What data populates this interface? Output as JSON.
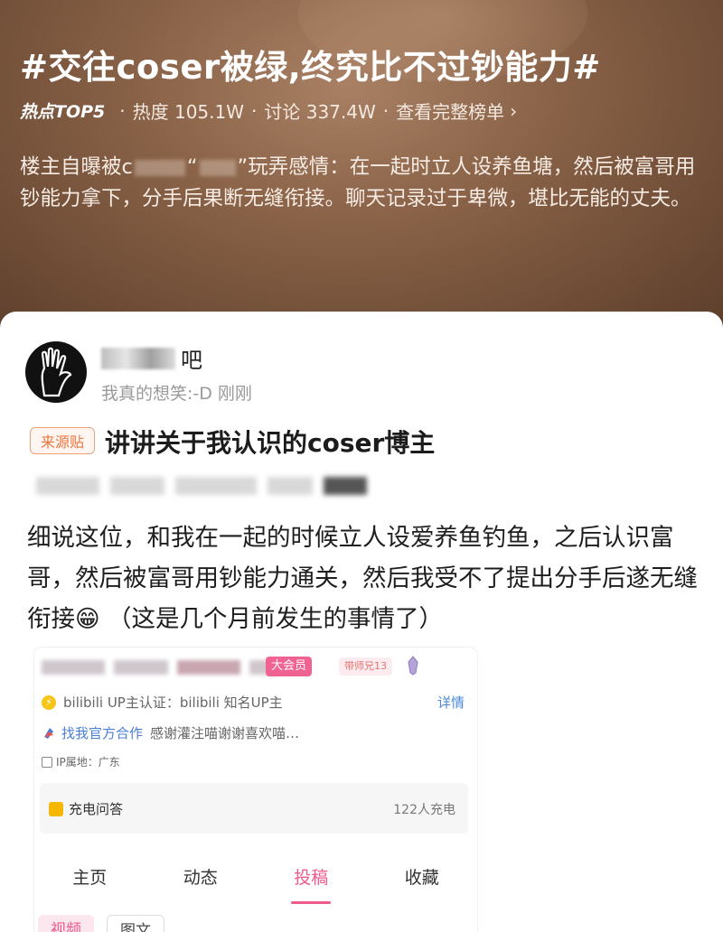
{
  "topic": {
    "title": "#交往coser被绿,终究比不过钞能力#",
    "badge": "热点TOP5",
    "heat": "热度 105.1W",
    "discussion": "讨论 337.4W",
    "full_list_link": "查看完整榜单",
    "desc_part1": "楼主自曝被c",
    "desc_part2": "玩弄感情：在一起时立人设养鱼塘，然后被富哥用钞能力拿下，分手后果断无缝衔接。聊天记录过于卑微，堪比无能的丈夫。"
  },
  "post": {
    "username_suffix": "吧",
    "subline": "我真的想笑:-D 刚刚",
    "source_tag": "来源贴",
    "title": "讲讲关于我认识的coser博主",
    "body": "细说这位，和我在一起的时候立人设爱养鱼钓鱼，之后认识富哥，然后被富哥用钞能力通关，然后我受不了提出分手后遂无缝衔接😁 （这是几个月前发生的事情了）"
  },
  "embedded_profile": {
    "vip": "大会员",
    "level_badge": "带师兄13",
    "certification": "bilibili UP主认证：bilibili 知名UP主",
    "detail_link": "详情",
    "coop_label": "找我官方合作",
    "coop_text": "感谢灌注喵谢谢喜欢喵…",
    "ip": "IP属地：广东",
    "qa_label": "充电问答",
    "qa_count": "122人充电",
    "tabs": [
      "主页",
      "动态",
      "投稿",
      "收藏"
    ],
    "active_tab": "投稿",
    "subtabs": [
      "视频",
      "图文"
    ]
  },
  "colors": {
    "accent_pink": "#ef5a8a",
    "source_orange": "#e8763f",
    "link_blue": "#4a8ad8"
  }
}
